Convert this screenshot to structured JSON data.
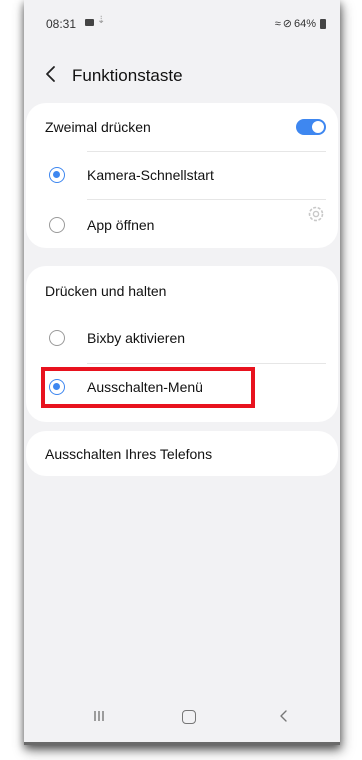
{
  "status_bar": {
    "time": "08:31",
    "download_glyph": "⇣",
    "wifi_glyph": "≈",
    "dnd_glyph": "⊘",
    "battery": "64%"
  },
  "header": {
    "title": "Funktionstaste"
  },
  "double_press": {
    "label": "Zweimal drücken",
    "enabled": true,
    "options": [
      {
        "label": "Kamera-Schnellstart",
        "selected": true
      },
      {
        "label": "App öffnen",
        "selected": false
      }
    ]
  },
  "press_and_hold": {
    "label": "Drücken und halten",
    "options": [
      {
        "label": "Bixby aktivieren",
        "selected": false
      },
      {
        "label": "Ausschalten-Menü",
        "selected": true
      }
    ]
  },
  "power_off": {
    "label": "Ausschalten Ihres Telefons"
  },
  "colors": {
    "accent": "#3e87f0",
    "highlight": "#e8121e",
    "background": "#f2f2f4"
  },
  "icons": {
    "back": "chevron-left-icon",
    "settings": "gear-icon",
    "nav_recent": "recent-apps-icon",
    "nav_home": "home-icon",
    "nav_back": "back-icon"
  }
}
